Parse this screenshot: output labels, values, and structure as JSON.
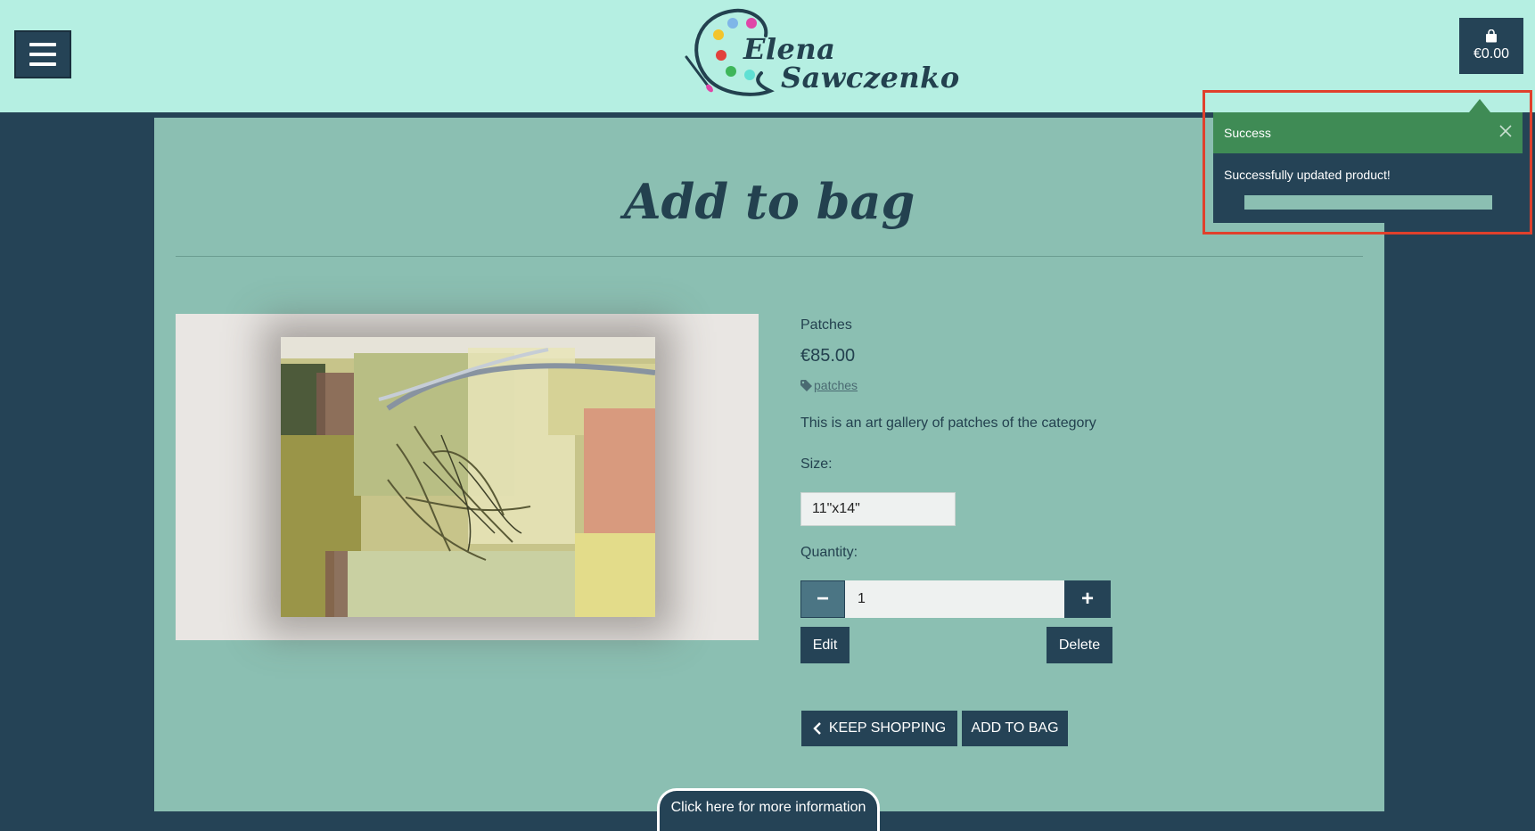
{
  "header": {
    "logo_line1": "Elena",
    "logo_line2": "Sawczenko",
    "cart_total": "€0.00",
    "menu_icon": "hamburger-icon",
    "cart_icon": "shopping-bag-icon"
  },
  "main": {
    "title": "Add to bag",
    "product": {
      "name": "Patches",
      "price": "€85.00",
      "tag": "patches",
      "description": "This is an art gallery of patches of the category",
      "size_label": "Size:",
      "size_value": "11\"x14\"",
      "quantity_label": "Quantity:",
      "quantity_value": "1"
    },
    "buttons": {
      "edit": "Edit",
      "delete": "Delete",
      "keep_shopping": "KEEP SHOPPING",
      "add_to_bag": "ADD TO BAG"
    }
  },
  "footer": {
    "info_tab": "Click here for more information"
  },
  "toast": {
    "title": "Success",
    "message": "Successfully updated product!",
    "progress": 1.0
  },
  "colors": {
    "header_bg": "#b5efe2",
    "page_bg": "#254356",
    "panel_bg": "#8bbfb2",
    "accent_dark": "#254356",
    "toast_header": "#3f8b55",
    "highlight_border": "#e0402c"
  }
}
